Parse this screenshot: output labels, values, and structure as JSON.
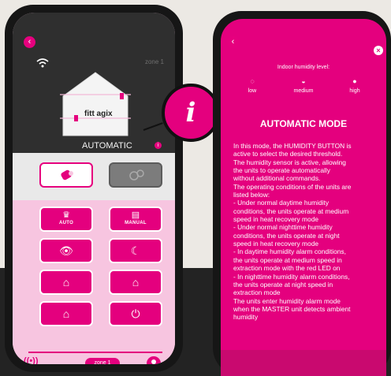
{
  "phone_left": {
    "zone_top_label": "zone 1",
    "house_brand": "fitt agix",
    "mode_label": "AUTOMATIC",
    "info_icon_glyph": "i",
    "toggle_buttons": [
      {
        "icon": "sensor-icon",
        "glyph": "⬤",
        "state": "on"
      },
      {
        "icon": "fan-icon",
        "glyph": "❋",
        "state": "off"
      }
    ],
    "grid_buttons": [
      {
        "icon": "auto-mode-icon",
        "glyph": "♛",
        "label": "AUTO"
      },
      {
        "icon": "manual-mode-icon",
        "glyph": "▤",
        "label": "MANUAL"
      },
      {
        "icon": "eye-icon",
        "glyph": "👁",
        "label": ""
      },
      {
        "icon": "moon-icon",
        "glyph": "☾",
        "label": ""
      },
      {
        "icon": "house-fan-icon",
        "glyph": "⌂",
        "label": ""
      },
      {
        "icon": "house-outline-icon",
        "glyph": "⌂",
        "label": ""
      },
      {
        "icon": "house-gear-icon",
        "glyph": "⌂",
        "label": ""
      },
      {
        "icon": "power-icon",
        "glyph": "⏻",
        "label": ""
      }
    ],
    "nav": {
      "zone_label": "zone 1"
    },
    "colors": {
      "accent": "#e4007e",
      "dark": "#2f2f2f",
      "pink_light": "#f7c5e0"
    }
  },
  "phone_right": {
    "close_glyph": "×",
    "humidity_title": "Indoor humidity level:",
    "humidity_levels": [
      "low",
      "medium",
      "high"
    ],
    "heading": "AUTOMATIC MODE",
    "body_lines": [
      "In this mode, the HUMIDITY BUTTON is",
      "active to select the desired threshold.",
      "The humidity sensor is active, allowing",
      "the units to operate automatically",
      "without additional commands.",
      "The operating conditions of the units are",
      "listed below:",
      "- Under normal daytime humidity",
      "conditions, the units operate at medium",
      "speed in heat recovery mode",
      "- Under normal nighttime humidity",
      "conditions, the units operate at night",
      "speed in heat recovery mode",
      "- In daytime humidity alarm conditions,",
      "the units operate at medium speed in",
      "extraction mode with the red LED on",
      "- In nighttime humidity alarm conditions,",
      "the units operate at night speed in",
      "extraction mode",
      "The units enter humidity alarm mode",
      "when the MASTER unit detects ambient",
      "humidity"
    ]
  }
}
